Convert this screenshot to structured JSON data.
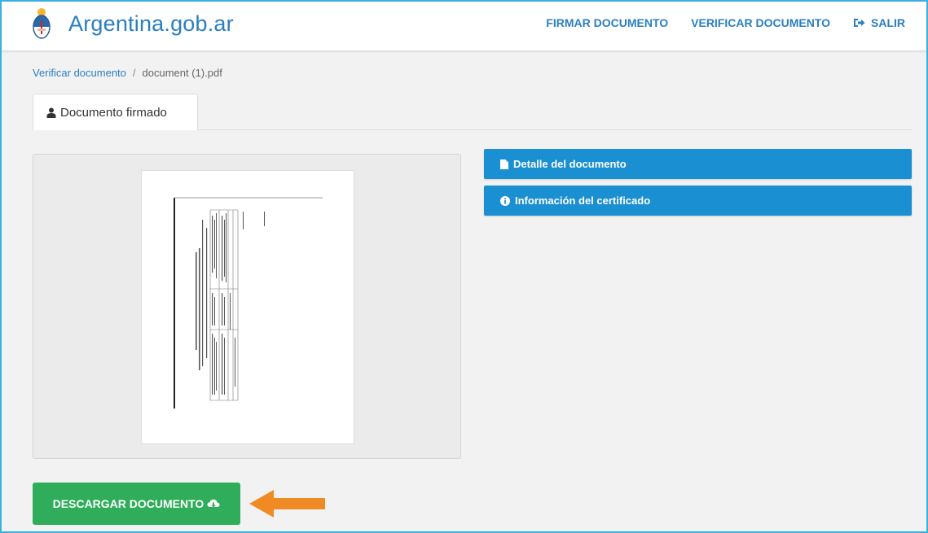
{
  "header": {
    "brand_name": "Argentina.gob.ar",
    "nav": {
      "firmar_label": "FIRMAR DOCUMENTO",
      "verificar_label": "VERIFICAR DOCUMENTO",
      "salir_label": "SALIR"
    }
  },
  "breadcrumb": {
    "link_label": "Verificar documento",
    "separator": "/",
    "current": "document (1).pdf"
  },
  "tabs": [
    {
      "label": "Documento firmado",
      "icon": "user-icon"
    }
  ],
  "panels": [
    {
      "label": "Detalle del documento",
      "icon": "file-icon"
    },
    {
      "label": "Información del certificado",
      "icon": "info-circle-icon"
    }
  ],
  "actions": {
    "download_label": "DESCARGAR DOCUMENTO",
    "download_icon": "cloud-download-icon"
  },
  "colors": {
    "brand_blue": "#2a7fbf",
    "panel_blue": "#1a8fd1",
    "success_green": "#2fad5b",
    "annotation_arrow": "#f08a24",
    "frame_border": "#3ab0e0"
  }
}
